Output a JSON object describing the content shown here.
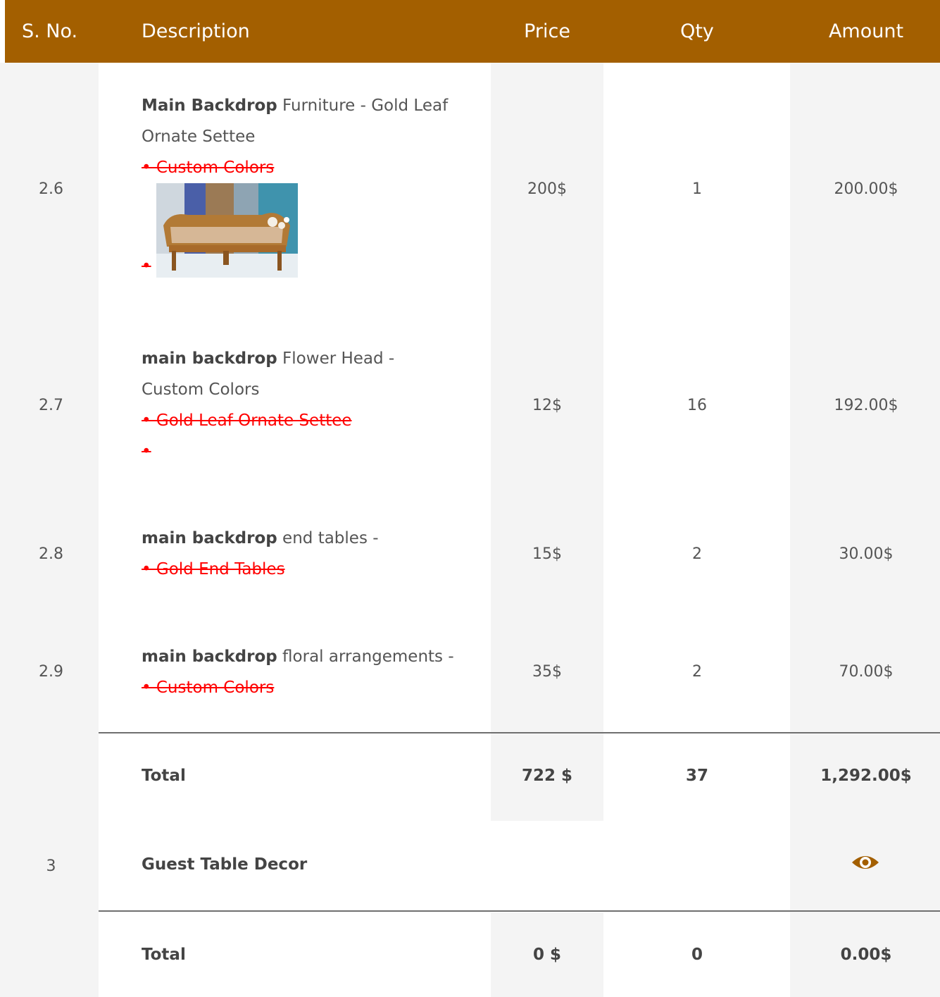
{
  "header": {
    "sno": "S. No.",
    "description": "Description",
    "price": "Price",
    "qty": "Qty",
    "amount": "Amount"
  },
  "rows": [
    {
      "sno": "2.6",
      "desc_bold": "Main Backdrop",
      "desc_rest": " Furniture - Gold Leaf Ornate Settee",
      "option": "• Custom Colors",
      "bullet": "•",
      "price": "200$",
      "qty": "1",
      "amount": "200.00$"
    },
    {
      "sno": "2.7",
      "desc_bold": "main backdrop",
      "desc_rest": " Flower Head - Custom Colors",
      "option": "• Gold Leaf Ornate Settee",
      "bullet": "•",
      "price": "12$",
      "qty": "16",
      "amount": "192.00$"
    },
    {
      "sno": "2.8",
      "desc_bold": "main backdrop",
      "desc_rest": " end tables -",
      "option": "• Gold End Tables",
      "price": "15$",
      "qty": "2",
      "amount": "30.00$"
    },
    {
      "sno": "2.9",
      "desc_bold": "main backdrop",
      "desc_rest": " floral arrangements -",
      "option": "• Custom Colors",
      "price": "35$",
      "qty": "2",
      "amount": "70.00$"
    }
  ],
  "total1": {
    "label": "Total",
    "price": "722 $",
    "qty": "37",
    "amount": "1,292.00$"
  },
  "section3": {
    "sno": "3",
    "title": "Guest Table Decor",
    "icon": "eye-icon"
  },
  "total2": {
    "label": "Total",
    "price": "0 $",
    "qty": "0",
    "amount": "0.00$"
  },
  "colors": {
    "header": "#a35f00",
    "accent": "#a35f00",
    "strike": "#ff0000",
    "stripe": "#f4f4f4"
  }
}
